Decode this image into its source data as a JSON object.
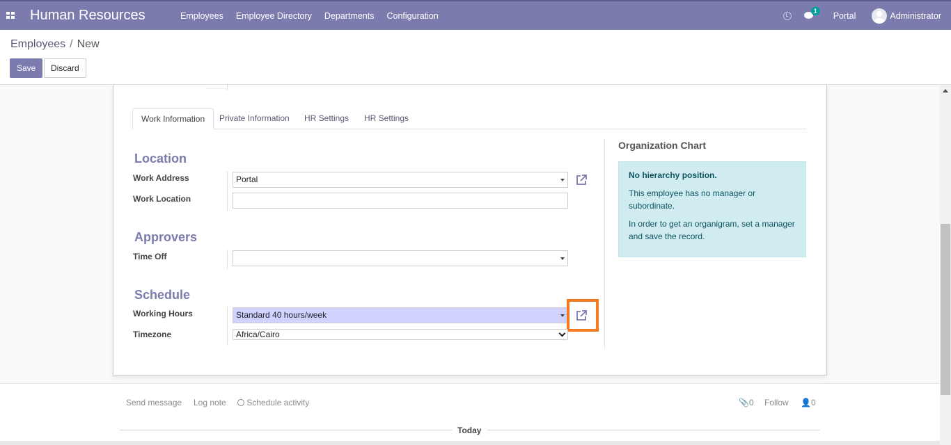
{
  "navbar": {
    "app_title": "Human Resources",
    "menu": [
      "Employees",
      "Employee Directory",
      "Departments",
      "Configuration"
    ],
    "chat_count": "1",
    "portal": "Portal",
    "user": "Administrator"
  },
  "breadcrumb": {
    "parent": "Employees",
    "separator": "/",
    "current": "New"
  },
  "buttons": {
    "save": "Save",
    "discard": "Discard"
  },
  "tabs": [
    "Work Information",
    "Private Information",
    "HR Settings",
    "HR Settings"
  ],
  "sections": {
    "location": "Location",
    "approvers": "Approvers",
    "schedule": "Schedule"
  },
  "fields": {
    "work_address": {
      "label": "Work Address",
      "value": "Portal"
    },
    "work_location": {
      "label": "Work Location",
      "value": ""
    },
    "time_off": {
      "label": "Time Off",
      "value": ""
    },
    "working_hours": {
      "label": "Working Hours",
      "value": "Standard 40 hours/week"
    },
    "timezone": {
      "label": "Timezone",
      "value": "Africa/Cairo"
    }
  },
  "org_chart": {
    "title": "Organization Chart",
    "alert_title": "No hierarchy position.",
    "alert_p1": "This employee has no manager or subordinate.",
    "alert_p2": "In order to get an organigram, set a manager and save the record."
  },
  "chatter": {
    "send_message": "Send message",
    "log_note": "Log note",
    "schedule_activity": "Schedule activity",
    "attachments": "0",
    "follow": "Follow",
    "followers": "0",
    "today": "Today"
  },
  "colors": {
    "brand": "#7c7bad",
    "highlight": "#f47a20",
    "alert_bg": "#d1ecf1"
  }
}
